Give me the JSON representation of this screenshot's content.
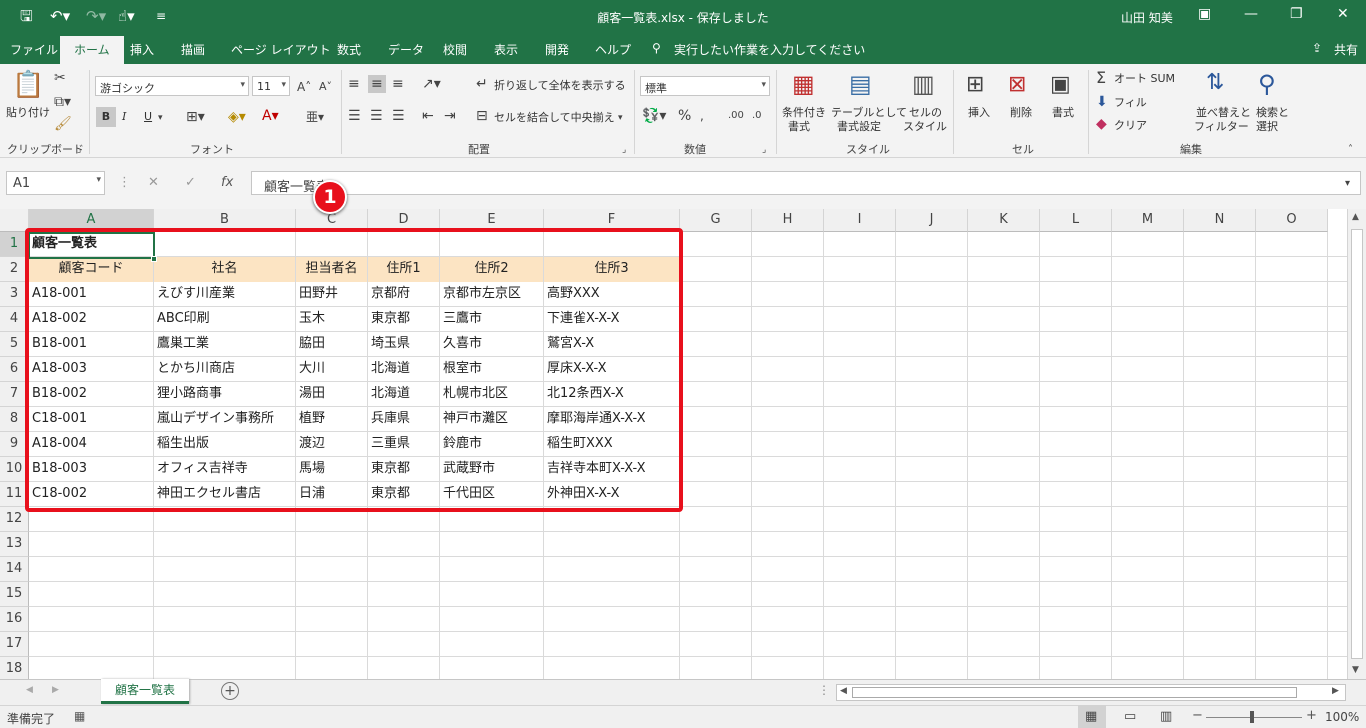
{
  "titlebar": {
    "title": "顧客一覧表.xlsx  -  保存しました",
    "user": "山田 知美",
    "save_icon": "save-icon",
    "undo_icon": "undo-icon",
    "redo_icon": "redo-icon",
    "touch_icon": "touch-mode-icon",
    "customize_icon": "customize-qat-icon"
  },
  "tabs": [
    "ファイル",
    "ホーム",
    "挿入",
    "描画",
    "ページ レイアウト",
    "数式",
    "データ",
    "校閲",
    "表示",
    "開発",
    "ヘルプ"
  ],
  "tell_me": "実行したい作業を入力してください",
  "share": "共有",
  "ribbon": {
    "clipboard": {
      "label": "クリップボード",
      "paste": "貼り付け"
    },
    "font": {
      "label": "フォント",
      "name": "游ゴシック",
      "size": "11",
      "bold": "B",
      "italic": "I",
      "underline": "U"
    },
    "alignment": {
      "label": "配置",
      "wrap": "折り返して全体を表示する",
      "merge": "セルを結合して中央揃え"
    },
    "number": {
      "label": "数値",
      "format": "標準"
    },
    "styles": {
      "label": "スタイル",
      "conditional_1": "条件付き",
      "conditional_2": "書式",
      "table_1": "テーブルとして",
      "table_2": "書式設定",
      "cell_1": "セルの",
      "cell_2": "スタイル"
    },
    "cells": {
      "label": "セル",
      "insert": "挿入",
      "delete": "削除",
      "format": "書式"
    },
    "editing": {
      "label": "編集",
      "autosum": "オート SUM",
      "fill": "フィル",
      "clear": "クリア",
      "sort_1": "並べ替えと",
      "sort_2": "フィルター",
      "find_1": "検索と",
      "find_2": "選択"
    }
  },
  "formula_bar": {
    "name_box": "A1",
    "formula": "顧客一覧表",
    "fx": "fx",
    "cancel": "✕",
    "enter": "✓"
  },
  "columns": [
    "A",
    "B",
    "C",
    "D",
    "E",
    "F",
    "G",
    "H",
    "I",
    "J",
    "K",
    "L",
    "M",
    "N",
    "O"
  ],
  "rows": [
    "1",
    "2",
    "3",
    "4",
    "5",
    "6",
    "7",
    "8",
    "9",
    "10",
    "11",
    "12",
    "13",
    "14",
    "15",
    "16",
    "17",
    "18"
  ],
  "sheet": {
    "title": "顧客一覧表",
    "headers": [
      "顧客コード",
      "社名",
      "担当者名",
      "住所1",
      "住所2",
      "住所3"
    ],
    "records": [
      [
        "A18-001",
        "えびす川産業",
        "田野井",
        "京都府",
        "京都市左京区",
        "高野XXX"
      ],
      [
        "A18-002",
        "ABC印刷",
        "玉木",
        "東京都",
        "三鷹市",
        "下連雀X-X-X"
      ],
      [
        "B18-001",
        "鷹巣工業",
        "脇田",
        "埼玉県",
        "久喜市",
        "鷲宮X-X"
      ],
      [
        "A18-003",
        "とかち川商店",
        "大川",
        "北海道",
        "根室市",
        "厚床X-X-X"
      ],
      [
        "B18-002",
        "狸小路商事",
        "湯田",
        "北海道",
        "札幌市北区",
        "北12条西X-X"
      ],
      [
        "C18-001",
        "嵐山デザイン事務所",
        "植野",
        "兵庫県",
        "神戸市灘区",
        "摩耶海岸通X-X-X"
      ],
      [
        "A18-004",
        "稲生出版",
        "渡辺",
        "三重県",
        "鈴鹿市",
        "稲生町XXX"
      ],
      [
        "B18-003",
        "オフィス吉祥寺",
        "馬場",
        "東京都",
        "武蔵野市",
        "吉祥寺本町X-X-X"
      ],
      [
        "C18-002",
        "神田エクセル書店",
        "日浦",
        "東京都",
        "千代田区",
        "外神田X-X-X"
      ]
    ]
  },
  "annotation": {
    "badge": "1",
    "color": "#e8101c"
  },
  "sheet_tab": "顧客一覧表",
  "add_sheet_icon": "add-sheet-icon",
  "status": {
    "ready": "準備完了",
    "zoom": "100%"
  },
  "colors": {
    "excel_green": "#217346",
    "header_fill": "#fce4c3",
    "highlight": "#e8101c"
  }
}
